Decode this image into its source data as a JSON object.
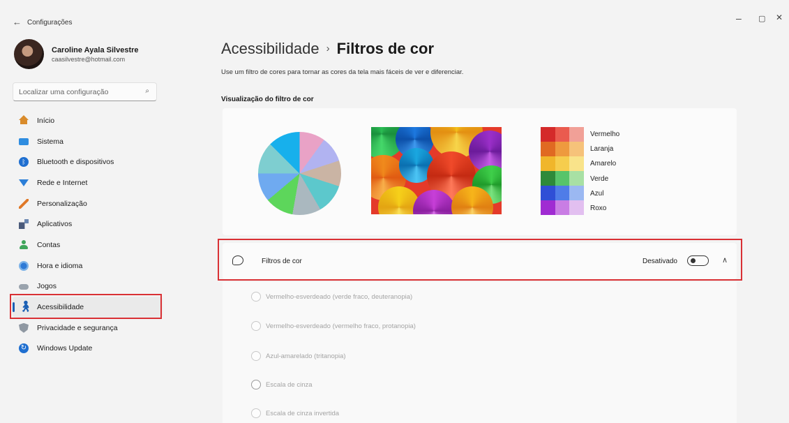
{
  "window": {
    "title": "Configurações",
    "back_icon": "←",
    "controls": [
      "–",
      "▢",
      "✕"
    ]
  },
  "profile": {
    "name": "Caroline Ayala Silvestre",
    "email": "caasilvestre@hotmail.com"
  },
  "search": {
    "placeholder": "Localizar uma configuração"
  },
  "sidebar": {
    "items": [
      {
        "label": "Início",
        "icon": "home-icon"
      },
      {
        "label": "Sistema",
        "icon": "system-icon"
      },
      {
        "label": "Bluetooth e dispositivos",
        "icon": "bluetooth-icon"
      },
      {
        "label": "Rede e Internet",
        "icon": "wifi-icon"
      },
      {
        "label": "Personalização",
        "icon": "brush-icon"
      },
      {
        "label": "Aplicativos",
        "icon": "apps-icon"
      },
      {
        "label": "Contas",
        "icon": "user-icon"
      },
      {
        "label": "Hora e idioma",
        "icon": "clock-globe-icon"
      },
      {
        "label": "Jogos",
        "icon": "gamepad-icon"
      },
      {
        "label": "Acessibilidade",
        "icon": "accessibility-icon",
        "active": true
      },
      {
        "label": "Privacidade e segurança",
        "icon": "shield-icon"
      },
      {
        "label": "Windows Update",
        "icon": "update-icon"
      }
    ]
  },
  "main": {
    "breadcrumb_parent": "Acessibilidade",
    "breadcrumb_sep": "›",
    "breadcrumb_current": "Filtros de cor",
    "description": "Use um filtro de cores para tornar as cores da tela mais fáceis de ver e diferenciar.",
    "preview_title": "Visualização do filtro de cor",
    "palette_labels": [
      "Vermelho",
      "Laranja",
      "Amarelo",
      "Verde",
      "Azul",
      "Roxo"
    ],
    "palette_colors": [
      [
        "#d42a2a",
        "#ea5b4f",
        "#f1a097"
      ],
      [
        "#e06a22",
        "#ee9a3e",
        "#f6c27a"
      ],
      [
        "#f0b62b",
        "#f6cd4d",
        "#f9e38a"
      ],
      [
        "#2e8a3a",
        "#57c46a",
        "#a8e0a4"
      ],
      [
        "#2f4fd6",
        "#4f7ce8",
        "#9bb8f2"
      ],
      [
        "#a02bd2",
        "#c97de4",
        "#e2bff0"
      ]
    ],
    "filter_row": {
      "label": "Filtros de cor",
      "status": "Desativado",
      "toggle_on": false
    },
    "options": [
      "Vermelho-esverdeado (verde fraco, deuteranopia)",
      "Vermelho-esverdeado (vermelho fraco, protanopia)",
      "Azul-amarelado (tritanopia)",
      "Escala de cinza",
      "Escala de cinza invertida"
    ]
  }
}
